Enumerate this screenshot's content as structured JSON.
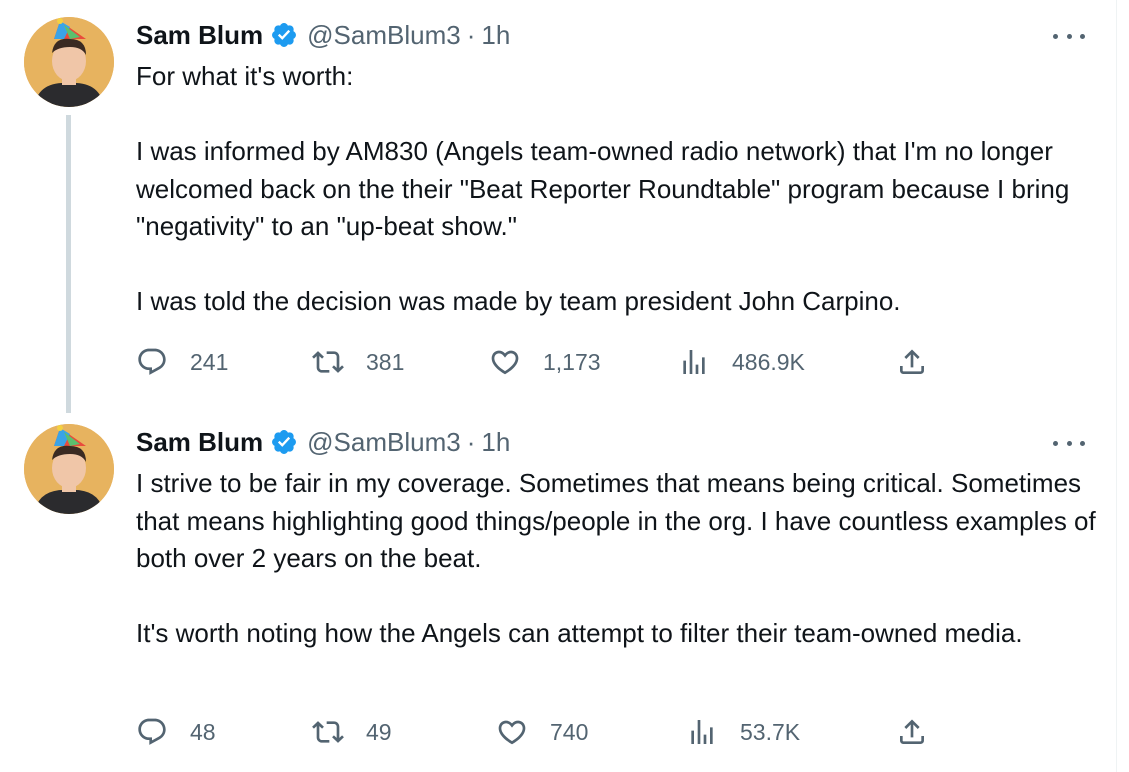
{
  "tweets": [
    {
      "author_name": "Sam Blum",
      "handle": "@SamBlum3",
      "separator": "·",
      "time": "1h",
      "paragraphs": [
        "For what it's worth:",
        "I was informed by AM830 (Angels team-owned radio network) that I'm no longer welcomed back on the their \"Beat Reporter Roundtable\" program because I bring \"negativity\" to an \"up-beat show.\"",
        "I was told the decision was made by team president John Carpino."
      ],
      "replies": "241",
      "reposts": "381",
      "likes": "1,173",
      "views": "486.9K"
    },
    {
      "author_name": "Sam Blum",
      "handle": "@SamBlum3",
      "separator": "·",
      "time": "1h",
      "paragraphs": [
        "I strive to be fair in my coverage. Sometimes that means being critical. Sometimes that means highlighting good things/people in the org. I have countless examples of both over 2 years on the beat.",
        "It's worth noting how the Angels can attempt to filter their team-owned media."
      ],
      "replies": "48",
      "reposts": "49",
      "likes": "740",
      "views": "53.7K"
    }
  ],
  "colors": {
    "text": "#0f1419",
    "secondary": "#536471",
    "verified": "#1d9bf0",
    "thread_line": "#cfd9de"
  },
  "icons": [
    "verified-badge-icon",
    "more-icon",
    "reply-icon",
    "repost-icon",
    "like-icon",
    "views-icon",
    "share-icon"
  ]
}
